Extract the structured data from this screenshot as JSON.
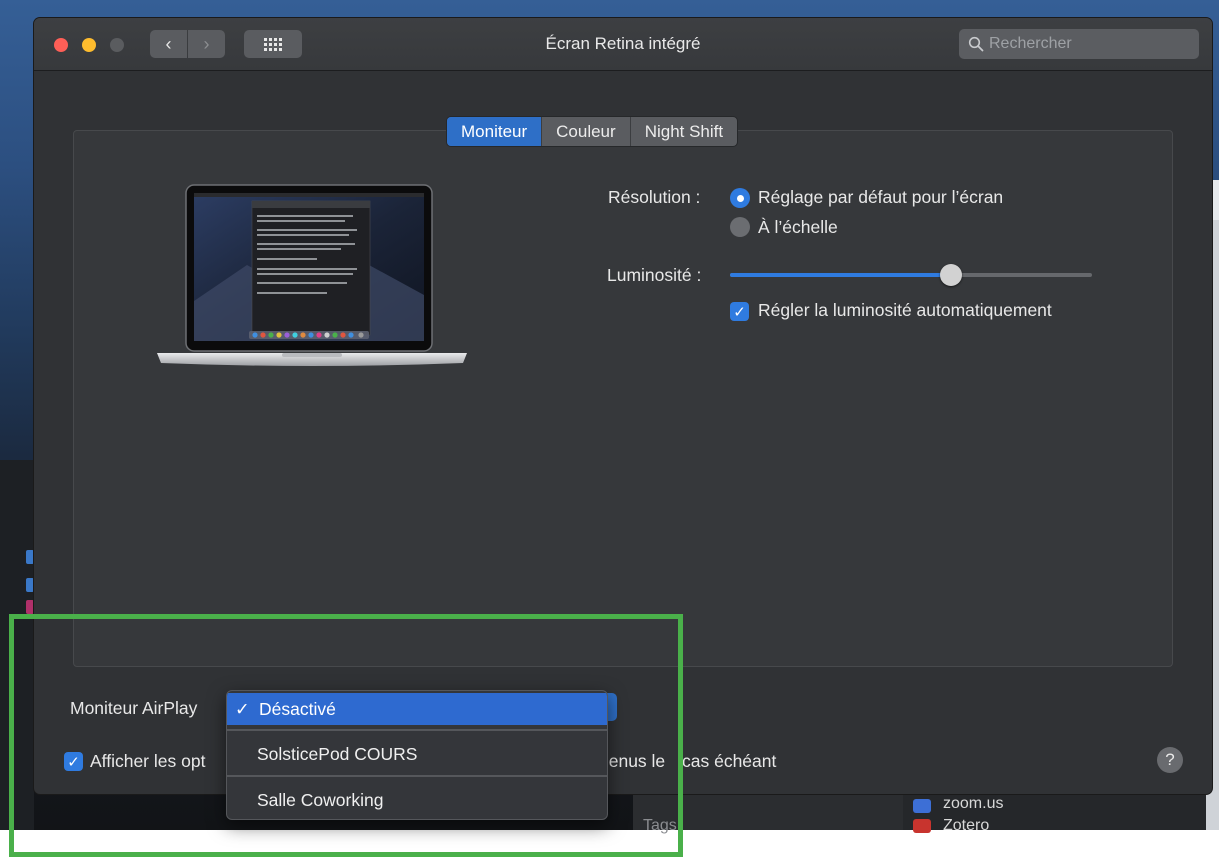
{
  "window": {
    "title": "Écran Retina intégré"
  },
  "search": {
    "placeholder": "Rechercher"
  },
  "tabs": [
    {
      "label": "Moniteur",
      "active": true
    },
    {
      "label": "Couleur",
      "active": false
    },
    {
      "label": "Night Shift",
      "active": false
    }
  ],
  "resolution": {
    "label": "Résolution :",
    "options": [
      {
        "label": "Réglage par défaut pour l’écran",
        "selected": true
      },
      {
        "label": "À l’échelle",
        "selected": false
      }
    ]
  },
  "brightness": {
    "label": "Luminosité :",
    "level": 0.61,
    "auto_label": "Régler la luminosité automatiquement",
    "auto_checked": true
  },
  "airplay": {
    "label": "Moniteur AirPlay",
    "menu_items": [
      {
        "label": "Désactivé",
        "checked": true,
        "check_mark": "✓"
      },
      {
        "label": "SolsticePod COURS",
        "checked": false
      },
      {
        "label": "Salle Coworking",
        "checked": false
      }
    ]
  },
  "mirroring": {
    "label_part1": "Afficher les opt",
    "label_part2": "nenus le",
    "label_part3": "cas échéant",
    "checked": true
  },
  "background": {
    "item_zoom": "zoom.us",
    "item_zotero": "Zotero",
    "item_tags": "Tags"
  },
  "colors": {
    "accent": "#2e6fc7",
    "window_bg": "#303235",
    "highlight": "#4ab04a"
  }
}
